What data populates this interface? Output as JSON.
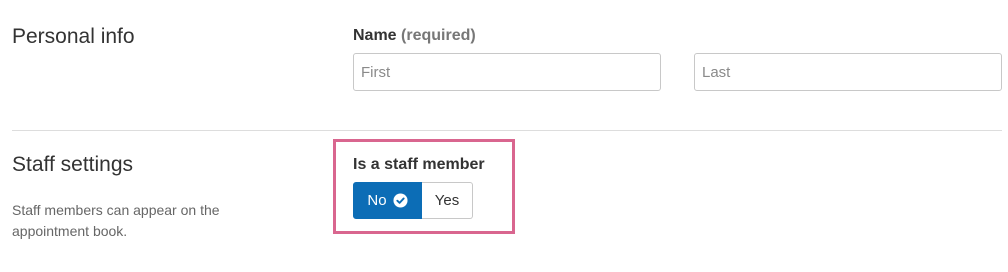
{
  "personal": {
    "title": "Personal info",
    "name_label": "Name",
    "name_required": "(required)",
    "first_placeholder": "First",
    "last_placeholder": "Last"
  },
  "staff": {
    "title": "Staff settings",
    "description": "Staff members can appear on the appointment book.",
    "field_label": "Is a staff member",
    "options": [
      "No",
      "Yes"
    ],
    "selected": "No"
  },
  "colors": {
    "accent": "#0c6db6",
    "highlight": "#d9668f"
  },
  "icons": {
    "selected_indicator": "check-circle-icon"
  }
}
